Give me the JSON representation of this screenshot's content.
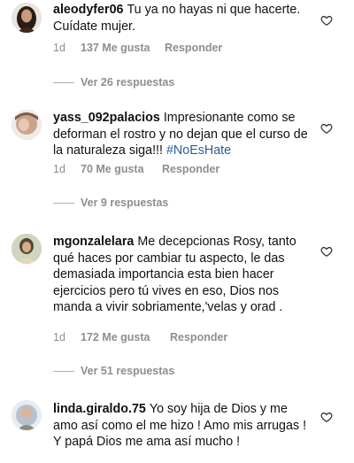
{
  "comments": [
    {
      "username": "aleodyfer06",
      "text": "Tu ya no hayas ni que hacerte. Cuídate mujer.",
      "hashtag": "",
      "time": "1d",
      "likes": "137 Me gusta",
      "reply_label": "Responder",
      "view_replies": "Ver 26 respuestas"
    },
    {
      "username": "yass_092palacios",
      "text": "Impresionante como se deforman el rostro y no dejan que el curso de la naturaleza siga!!!",
      "hashtag": "#NoEsHate",
      "time": "1d",
      "likes": "70 Me gusta",
      "reply_label": "Responder",
      "view_replies": "Ver 9 respuestas"
    },
    {
      "username": "mgonzalelara",
      "text": "Me decepcionas Rosy, tanto qué haces por cambiar tu aspecto, le das demasiada importancia esta bien hacer ejercicios pero tú vives en eso, Dios  nos manda a vivir sobriamente,'velas y orad .",
      "hashtag": "",
      "time": "1d",
      "likes": "172 Me gusta",
      "reply_label": "Responder",
      "view_replies": "Ver 51 respuestas"
    },
    {
      "username": "linda.giraldo.75",
      "text": "Yo soy hija de Dios y me amo así como el me hizo ! Amo mis arrugas ! Y papá Dios me ama así mucho !",
      "hashtag": "",
      "time": "",
      "likes": "",
      "reply_label": "",
      "view_replies": ""
    }
  ],
  "icons": {
    "like": "heart-outline-icon"
  }
}
